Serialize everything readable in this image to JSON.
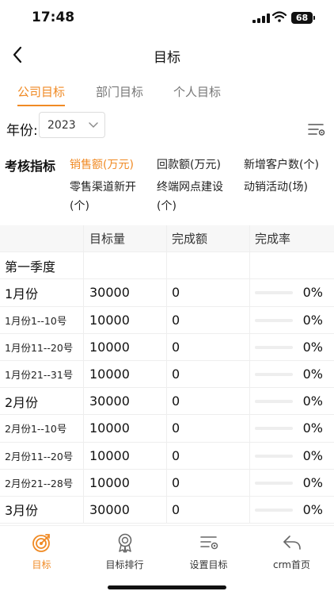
{
  "status_bar": {
    "time": "17:48",
    "battery": "68"
  },
  "navbar": {
    "title": "目标"
  },
  "tabs": [
    {
      "label": "公司目标",
      "active": true
    },
    {
      "label": "部门目标",
      "active": false
    },
    {
      "label": "个人目标",
      "active": false
    }
  ],
  "filter": {
    "year_label": "年份:",
    "year_value": "2023"
  },
  "metrics": {
    "label": "考核指标",
    "items": [
      {
        "line1": "销售额(万元)",
        "line2": "",
        "active": true
      },
      {
        "line1": "回款额(万元)",
        "line2": "",
        "active": false
      },
      {
        "line1": "新增客户数(个)",
        "line2": "",
        "active": false
      },
      {
        "line1": "零售渠道新开",
        "line2": "(个)",
        "active": false
      },
      {
        "line1": "终端网点建设",
        "line2": "(个)",
        "active": false
      },
      {
        "line1": "动销活动(场)",
        "line2": "",
        "active": false
      }
    ]
  },
  "table": {
    "headers": [
      "",
      "目标量",
      "完成额",
      "完成率"
    ],
    "rows": [
      {
        "type": "quarter",
        "label": "第一季度"
      },
      {
        "type": "month",
        "label": "1月份",
        "target": "30000",
        "done": "0",
        "rate": "0%",
        "progress": 0
      },
      {
        "type": "period",
        "label": "1月份1--10号",
        "target": "10000",
        "done": "0",
        "rate": "0%",
        "progress": 0
      },
      {
        "type": "period",
        "label": "1月份11--20号",
        "target": "10000",
        "done": "0",
        "rate": "0%",
        "progress": 0
      },
      {
        "type": "period",
        "label": "1月份21--31号",
        "target": "10000",
        "done": "0",
        "rate": "0%",
        "progress": 0
      },
      {
        "type": "month",
        "label": "2月份",
        "target": "30000",
        "done": "0",
        "rate": "0%",
        "progress": 0
      },
      {
        "type": "period",
        "label": "2月份1--10号",
        "target": "10000",
        "done": "0",
        "rate": "0%",
        "progress": 0
      },
      {
        "type": "period",
        "label": "2月份11--20号",
        "target": "10000",
        "done": "0",
        "rate": "0%",
        "progress": 0
      },
      {
        "type": "period",
        "label": "2月份21--28号",
        "target": "10000",
        "done": "0",
        "rate": "0%",
        "progress": 0
      },
      {
        "type": "month",
        "label": "3月份",
        "target": "30000",
        "done": "0",
        "rate": "0%",
        "progress": 0
      }
    ]
  },
  "bottom_nav": [
    {
      "label": "目标",
      "icon": "target-icon",
      "active": true
    },
    {
      "label": "目标排行",
      "icon": "ranking-icon",
      "active": false
    },
    {
      "label": "设置目标",
      "icon": "settings-list-icon",
      "active": false
    },
    {
      "label": "crm首页",
      "icon": "back-arrow-icon",
      "active": false
    }
  ],
  "colors": {
    "accent": "#f08a24",
    "text": "#222222",
    "muted": "#777777",
    "border": "#eeeeee"
  }
}
